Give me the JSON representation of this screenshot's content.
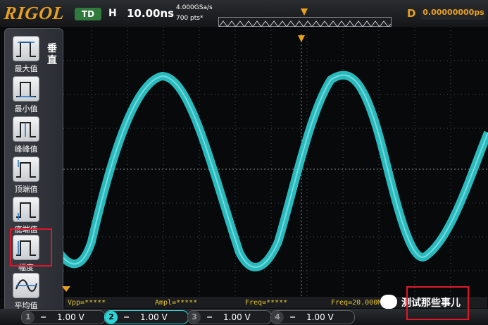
{
  "header": {
    "brand": "RIGOL",
    "trigger_mode": "TD",
    "h_label": "H",
    "timebase": "10.00ns",
    "sample_rate": "4.000GSa/s",
    "memory_depth": "700 pts*",
    "delay_label": "D",
    "delay_value": "0.00000000ps"
  },
  "side_menu": {
    "title": "垂直",
    "items": [
      {
        "label": "最大值",
        "icon": "max-icon"
      },
      {
        "label": "最小值",
        "icon": "min-icon"
      },
      {
        "label": "峰峰值",
        "icon": "peak-peak-icon"
      },
      {
        "label": "顶端值",
        "icon": "top-icon"
      },
      {
        "label": "底端值",
        "icon": "base-icon"
      },
      {
        "label": "幅度",
        "icon": "amplitude-icon",
        "selected": true
      },
      {
        "label": "平均值",
        "icon": "average-icon"
      }
    ]
  },
  "measurements": {
    "vpp": "Vpp=*****",
    "ampl": "Ampl=*****",
    "freq_a": "Freq=*****",
    "freq_b": "Freq=20.000M"
  },
  "channels": [
    {
      "num": "1",
      "coupling": "=",
      "scale": "1.00 V",
      "color": "#e8c430"
    },
    {
      "num": "2",
      "coupling": "=",
      "scale": "1.00 V",
      "color": "#2fd3d6"
    },
    {
      "num": "3",
      "coupling": "=",
      "scale": "1.00 V",
      "color": "#d45ab0"
    },
    {
      "num": "4",
      "coupling": "=",
      "scale": "1.00 V",
      "color": "#3a7fd8"
    }
  ],
  "watermark": {
    "text": "测试那些事儿",
    "icon": "wechat-icon"
  },
  "colors": {
    "accent": "#e8a020",
    "trace": "#2fd3d6",
    "highlight": "#e0162b"
  }
}
